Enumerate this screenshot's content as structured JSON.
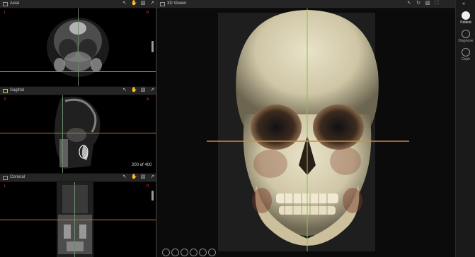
{
  "panels": {
    "axial": {
      "title": "Axial",
      "left": "L",
      "right": "R"
    },
    "sagittal": {
      "title": "Sagittal",
      "left": "P",
      "right": "A",
      "slice": "200 of 400"
    },
    "coronal": {
      "title": "Coronal",
      "left": "L",
      "right": "R"
    }
  },
  "viewer3d": {
    "title": "3D Viewer"
  },
  "sidebar": {
    "items": [
      {
        "label": "Patient",
        "icon": "patient-icon"
      },
      {
        "label": "Diagnose",
        "icon": "diagnose-icon"
      },
      {
        "label": "Ceph",
        "icon": "ceph-icon"
      }
    ]
  },
  "colors": {
    "crosshair_orange": "#d08a3a",
    "crosshair_green": "#8fbf4f",
    "orient_red": "#e03a3a",
    "bone": "#d9d2b5"
  }
}
